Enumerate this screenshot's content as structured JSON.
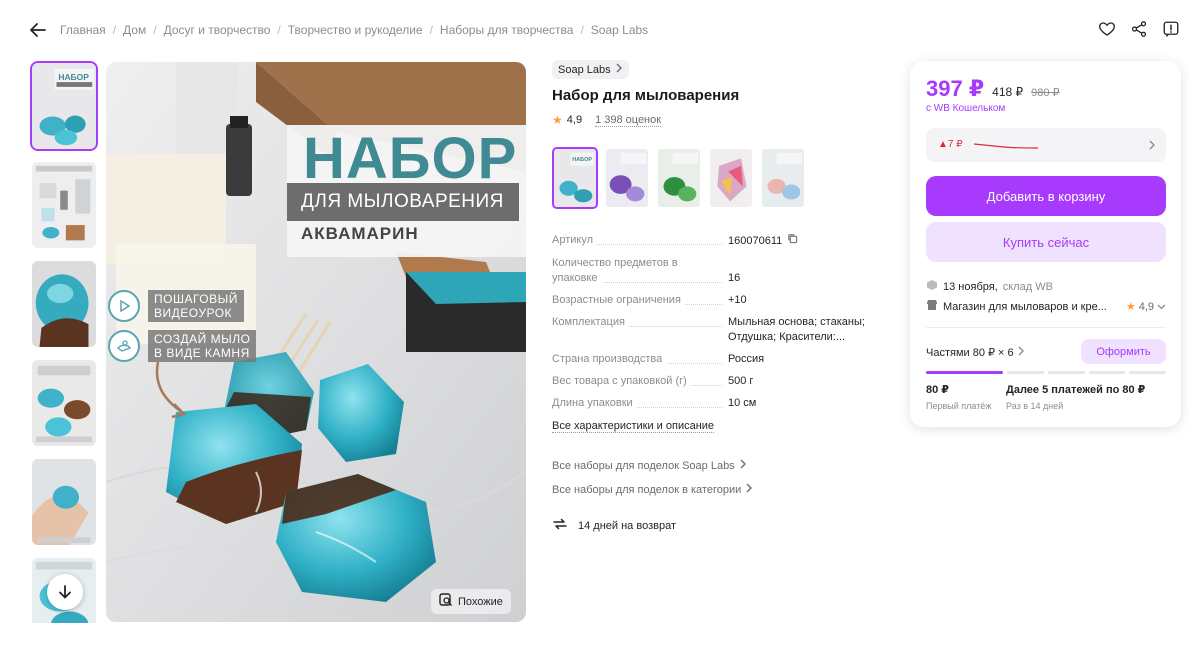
{
  "breadcrumbs": [
    "Главная",
    "Дом",
    "Досуг и творчество",
    "Творчество и рукоделие",
    "Наборы для творчества",
    "Soap Labs"
  ],
  "icons": {
    "back": "arrow-left-icon",
    "favorite": "heart-icon",
    "share": "share-icon",
    "report": "report-icon",
    "scroll": "arrow-down-icon",
    "similar": "similar-search-icon",
    "return": "return-arrows-icon"
  },
  "image": {
    "title_big": "НАБОР",
    "title_sub": "ДЛЯ МЫЛОВАРЕНИЯ",
    "title_aqua": "АКВАМАРИН",
    "badge1": "ПОШАГОВЫЙ\nВИДЕОУРОК",
    "badge2": "СОЗДАЙ МЫЛО\nВ ВИДЕ КАМНЯ",
    "similar_label": "Похожие"
  },
  "product": {
    "brand": "Soap Labs",
    "name": "Набор для мыловарения",
    "rating": "4,9",
    "reviews": "1 398 оценок"
  },
  "specs": [
    {
      "k": "Артикул",
      "v": "160070611"
    },
    {
      "k": "Количество предметов в упаковке",
      "v": "16"
    },
    {
      "k": "Возрастные ограничения",
      "v": "+10"
    },
    {
      "k": "Комплектация",
      "v": "Мыльная основа; стаканы; Отдушка; Красители:..."
    },
    {
      "k": "Страна производства",
      "v": "Россия"
    },
    {
      "k": "Вес товара с упаковкой (г)",
      "v": "500 г"
    },
    {
      "k": "Длина упаковки",
      "v": "10 см"
    }
  ],
  "links": {
    "all_specs": "Все характеристики и описание",
    "brand_sets": "Все наборы для поделок Soap Labs",
    "category_sets": "Все наборы для поделок в категории",
    "returns": "14 дней на возврат"
  },
  "buy": {
    "price": "397 ₽",
    "price_no_wallet": "418 ₽",
    "price_old": "980 ₽",
    "wallet_note": "с WB Кошельком",
    "price_change": "▲7 ₽",
    "add_to_cart": "Добавить в корзину",
    "buy_now": "Купить сейчас",
    "delivery_date": "13 ноября,",
    "delivery_from": "склад WB",
    "shop_name": "Магазин для мыловаров и кре...",
    "shop_rating": "4,9",
    "installments": "Частями 80 ₽ × 6",
    "order_button": "Оформить",
    "first_payment": "80 ₽",
    "first_payment_note": "Первый платёж",
    "next_payments": "Далее 5 платежей по 80 ₽",
    "next_payments_note": "Раз в 14 дней"
  },
  "colors": {
    "accent": "#a73afd",
    "accent_light": "#f0e2fe",
    "muted": "#8b8b96",
    "price_up": "#e0283b"
  }
}
